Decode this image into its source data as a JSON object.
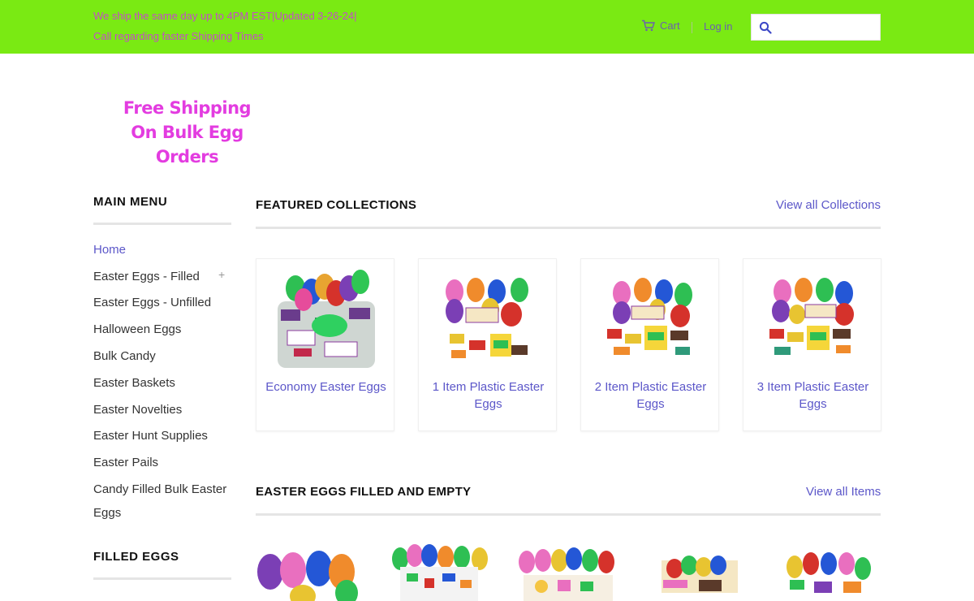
{
  "topbar": {
    "shipping_line1": "We ship the same day up to 4PM EST|Updated 3-26-24|",
    "shipping_line2": "Call regarding faster Shipping Times",
    "cart_label": "Cart",
    "login_label": "Log in",
    "search_placeholder": "",
    "icons": [
      "cart-icon",
      "search-icon"
    ],
    "bar_color": "#7aea13"
  },
  "logo": {
    "line1": "Free Shipping",
    "line2": "On Bulk Egg Orders",
    "color": "#e33ce0"
  },
  "sidebar": {
    "main_menu_title": "MAIN MENU",
    "items": [
      {
        "label": "Home"
      },
      {
        "label": "Easter Eggs - Filled"
      },
      {
        "label": "Easter Eggs - Unfilled"
      },
      {
        "label": "Halloween Eggs"
      },
      {
        "label": "Bulk Candy"
      },
      {
        "label": "Easter Baskets"
      },
      {
        "label": "Easter Novelties"
      },
      {
        "label": "Easter Hunt Supplies"
      },
      {
        "label": "Easter Pails"
      },
      {
        "label": "Candy Filled Bulk Easter Eggs"
      }
    ],
    "expand_symbol": "+",
    "filled_eggs_title": "FILLED EGGS"
  },
  "featured": {
    "title": "FEATURED COLLECTIONS",
    "view_all": "View all Collections",
    "collections": [
      {
        "label": "Economy Easter Eggs"
      },
      {
        "label": "1 Item Plastic Easter Eggs"
      },
      {
        "label": "2 Item Plastic Easter Eggs"
      },
      {
        "label": "3 Item Plastic Easter Eggs"
      }
    ]
  },
  "eggs_section": {
    "title": "EASTER EGGS FILLED AND EMPTY",
    "view_all": "View all Items"
  },
  "colors": {
    "link": "#5c57c9",
    "accent_text": "#c54bc8"
  }
}
